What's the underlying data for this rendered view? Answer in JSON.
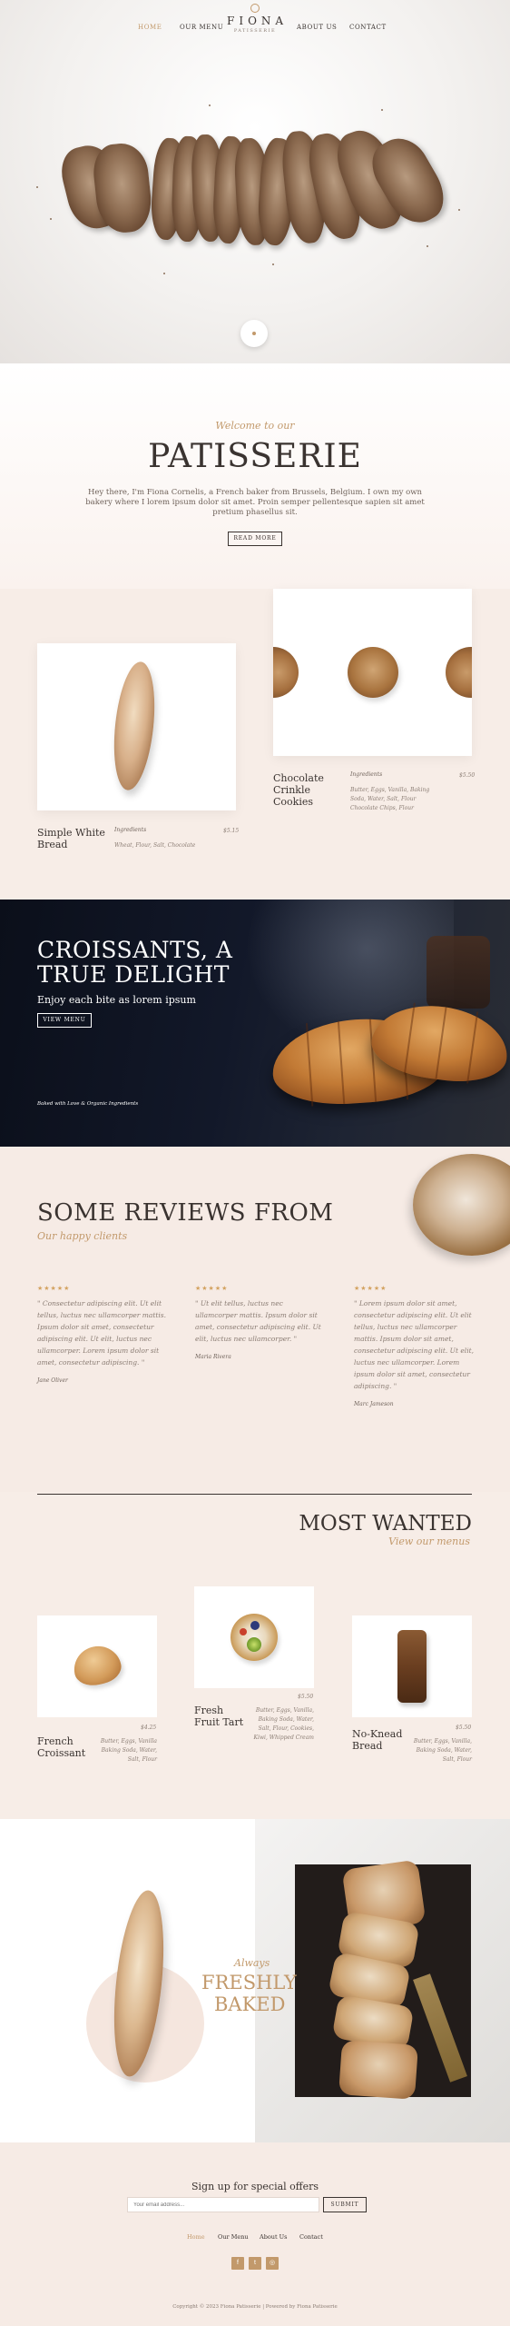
{
  "nav": {
    "items_left": [
      {
        "label": "HOME",
        "active": true
      },
      {
        "label": "OUR MENU",
        "active": false
      }
    ],
    "items_right": [
      {
        "label": "ABOUT US",
        "active": false
      },
      {
        "label": "CONTACT",
        "active": false
      }
    ],
    "logo_title": "FIONA",
    "logo_subtitle": "PATISSERIE"
  },
  "welcome": {
    "script": "Welcome to our",
    "title": "PATISSERIE",
    "body": "Hey there, I'm Fiona Cornelis, a French baker from Brussels, Belgium. I own my own bakery where I lorem ipsum dolor sit amet. Proin semper pellentesque sapien sit amet pretium phasellus sit.",
    "button": "READ MORE"
  },
  "products_top": [
    {
      "name_line1": "Simple White",
      "name_line2": "Bread",
      "ingredients_label": "Ingredients",
      "price": "$5.15",
      "ingredients": "Wheat, Flour, Salt, Chocolate"
    },
    {
      "name_line1": "Chocolate",
      "name_line2": "Crinkle",
      "name_line3": "Cookies",
      "ingredients_label": "Ingredients",
      "price": "$5.50",
      "ingredients_l1": "Butter, Eggs, Vanilla, Baking",
      "ingredients_l2": "Soda, Water, Salt, Flour",
      "ingredients_l3": "Chocolate Chips, Flour"
    }
  ],
  "banner": {
    "title_line1": "CROISSANTS, A",
    "title_line2": "TRUE DELIGHT",
    "subtitle": "Enjoy each bite as lorem ipsum",
    "button": "VIEW MENU",
    "caption": "Baked with Love & Organic Ingredients"
  },
  "reviews": {
    "title": "SOME REVIEWS FROM",
    "script": "Our happy clients",
    "items": [
      {
        "stars": "★★★★★",
        "text": "\" Consectetur adipiscing elit. Ut elit tellus, luctus nec ullamcorper mattis. Ipsum dolor sit amet, consectetur adipiscing elit. Ut elit, luctus nec ullamcorper. Lorem ipsum dolor sit amet, consectetur adipiscing. \"",
        "author": "Jane Oliver"
      },
      {
        "stars": "★★★★★",
        "text": "\" Ut elit tellus, luctus nec ullamcorper mattis. Ipsum dolor sit amet, consectetur adipiscing elit. Ut elit, luctus nec ullamcorper. \"",
        "author": "Maria Rivera"
      },
      {
        "stars": "★★★★★",
        "text": "\" Lorem ipsum dolor sit amet, consectetur adipiscing elit. Ut elit tellus, luctus nec ullamcorper mattis. Ipsum dolor sit amet, consectetur adipiscing elit. Ut elit, luctus nec ullamcorper. Lorem ipsum dolor sit amet, consectetur adipiscing. \"",
        "author": "Marc Jameson"
      }
    ]
  },
  "wanted": {
    "title": "MOST WANTED",
    "script": "View our menus",
    "items": [
      {
        "name_line1": "French",
        "name_line2": "Croissant",
        "price": "$4.25",
        "ingredients_l1": "Butter, Eggs, Vanilla",
        "ingredients_l2": "Baking Soda, Water,",
        "ingredients_l3": "Salt, Flour"
      },
      {
        "name_line1": "Fresh",
        "name_line2": "Fruit Tart",
        "price": "$5.50",
        "ingredients_l1": "Butter, Eggs, Vanilla,",
        "ingredients_l2": "Baking Soda, Water,",
        "ingredients_l3": "Salt, Flour, Cookies,",
        "ingredients_l4": "Kiwi, Whipped Cream"
      },
      {
        "name_line1": "No-Knead",
        "name_line2": "Bread",
        "price": "$5.50",
        "ingredients_l1": "Butter, Eggs, Vanilla,",
        "ingredients_l2": "Baking Soda, Water,",
        "ingredients_l3": "Salt, Flour"
      }
    ]
  },
  "fresh": {
    "script": "Always",
    "line1": "FRESHLY",
    "line2": "BAKED"
  },
  "footer": {
    "signup_title": "Sign up for special offers",
    "email_placeholder": "Your email address...",
    "submit": "SUBMIT",
    "links": [
      {
        "label": "Home",
        "active": true
      },
      {
        "label": "Our Menu",
        "active": false
      },
      {
        "label": "About Us",
        "active": false
      },
      {
        "label": "Contact",
        "active": false
      }
    ],
    "social": [
      {
        "icon": "facebook-icon",
        "glyph": "f"
      },
      {
        "icon": "twitter-icon",
        "glyph": "t"
      },
      {
        "icon": "instagram-icon",
        "glyph": "◎"
      }
    ],
    "copyright": "Copyright © 2023 Fiona Patisserie | Powered by Fiona Patisserie"
  },
  "colors": {
    "accent": "#c2996b",
    "text": "#3a3330",
    "banner_bg": "#121829",
    "page_bg": "#f7ede7"
  }
}
